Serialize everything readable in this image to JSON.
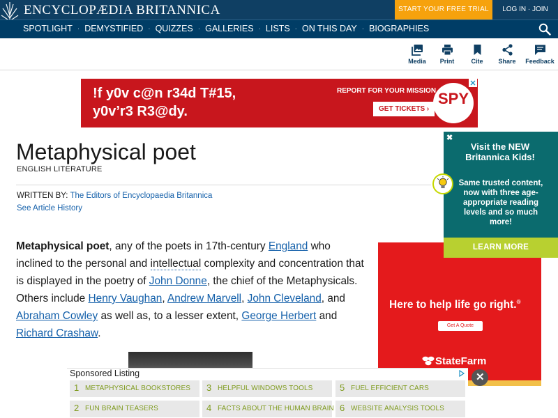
{
  "header": {
    "brand": "ENCYCLOPÆDIA BRITANNICA",
    "trial_label": "START YOUR FREE TRIAL",
    "login_label": "LOG IN · JOIN"
  },
  "nav": {
    "items": [
      "SPOTLIGHT",
      "DEMYSTIFIED",
      "QUIZZES",
      "GALLERIES",
      "LISTS",
      "ON THIS DAY",
      "BIOGRAPHIES"
    ],
    "separator": "·",
    "search_icon": "search-icon"
  },
  "tools": [
    {
      "label": "Media",
      "icon": "media-icon"
    },
    {
      "label": "Print",
      "icon": "print-icon"
    },
    {
      "label": "Cite",
      "icon": "bookmark-icon"
    },
    {
      "label": "Share",
      "icon": "share-icon"
    },
    {
      "label": "Feedback",
      "icon": "feedback-icon"
    }
  ],
  "ad_banner": {
    "headline_line1": "!f y0v c@n r34d T#15,",
    "headline_line2": "y0v’r3 R3@dy.",
    "report": "REPORT FOR YOUR MISSION",
    "tickets": "GET TICKETS ›",
    "brand": "SPY",
    "color": "#c8161d"
  },
  "article": {
    "title": "Metaphysical poet",
    "category": "ENGLISH LITERATURE",
    "written_by_label": "WRITTEN BY:",
    "author": "The Editors of Encyclopaedia Britannica",
    "history_link": "See Article History",
    "body": {
      "term": "Metaphysical poet",
      "t1": ", any of the poets in 17th-century ",
      "l_england": "England",
      "t2": " who inclined to the personal and ",
      "l_intellectual": "intellectual",
      "t3": " complexity and concentration that is displayed in the poetry of ",
      "l_donne": "John Donne",
      "t4": ", the chief of the Metaphysicals. Others include ",
      "l_vaughan": "Henry Vaughan",
      "t5": ", ",
      "l_marvell": "Andrew Marvell",
      "t6": ", ",
      "l_cleveland": "John Cleveland",
      "t7": ", and ",
      "l_cowley": "Abraham Cowley",
      "t8": " as well as, to a lesser extent, ",
      "l_herbert": "George Herbert",
      "t9": " and ",
      "l_crashaw": "Richard Crashaw",
      "t10": "."
    }
  },
  "ad_right": {
    "headline": "Here to help life go right.",
    "trademark": "®",
    "button": "Get A Quote",
    "logo": "StateFarm",
    "color": "#e41a1c"
  },
  "kids_popup": {
    "close": "✖",
    "title": "Visit the NEW Britannica Kids!",
    "description": "Same trusted content, now with three age-appropriate reading levels and so much more!",
    "learn_more": "LEARN MORE",
    "icon": "lightbulb-icon"
  },
  "sponsored": {
    "title": "Sponsored Listing",
    "items": [
      {
        "num": "1",
        "label": "METAPHYSICAL BOOKSTORES"
      },
      {
        "num": "3",
        "label": "HELPFUL WINDOWS TOOLS"
      },
      {
        "num": "5",
        "label": "FUEL EFFICIENT CARS"
      },
      {
        "num": "2",
        "label": "FUN BRAIN TEASERS"
      },
      {
        "num": "4",
        "label": "FACTS ABOUT THE HUMAN BRAIN"
      },
      {
        "num": "6",
        "label": "WEBSITE ANALYSIS TOOLS"
      }
    ],
    "close": "✕"
  }
}
